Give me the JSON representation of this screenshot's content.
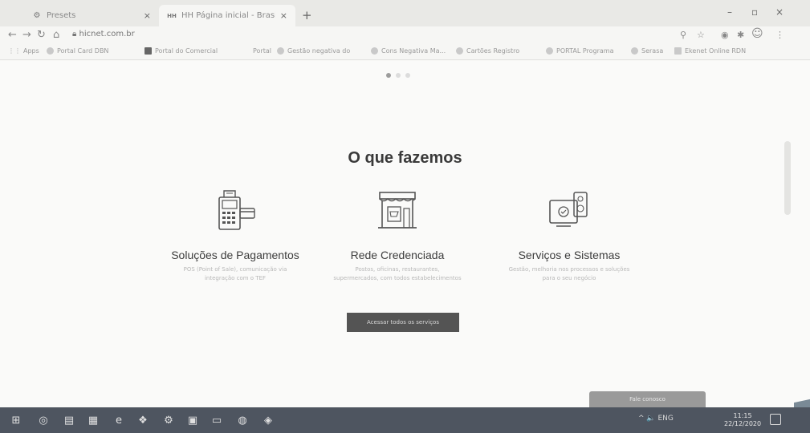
{
  "browser": {
    "tabs": [
      {
        "icon": "gear-icon",
        "label": "Presets"
      },
      {
        "icon": "hh-icon",
        "label": "HH Página inicial - Brasil"
      }
    ],
    "close_glyph": "×",
    "new_tab_glyph": "+",
    "address": "hicnet.com.br",
    "bookmarks": [
      {
        "label": "Apps"
      },
      {
        "label": "Portal Card DBN"
      },
      {
        "label": "Portal do Comercial"
      },
      {
        "label": "Portal"
      },
      {
        "label": "Gestão negativa do"
      },
      {
        "label": "Cons Negativa Ma..."
      },
      {
        "label": "Cartões Registro"
      },
      {
        "label": "PORTAL Programa"
      },
      {
        "label": "Serasa"
      },
      {
        "label": "Ekenet Online RDN"
      }
    ]
  },
  "page": {
    "section_title": "O que fazemos",
    "carousel": {
      "count": 3,
      "active": 0
    },
    "services": [
      {
        "icon": "payment-terminal-icon",
        "title": "Soluções de Pagamentos",
        "description": "POS (Point of Sale), comunicação via integração com o TEF"
      },
      {
        "icon": "storefront-icon",
        "title": "Rede Credenciada",
        "description": "Postos, oficinas, restaurantes, supermercados, com todos estabelecimentos"
      },
      {
        "icon": "systems-screen-icon",
        "title": "Serviços e Sistemas",
        "description": "Gestão, melhoria nos processos e soluções para o seu negócio"
      }
    ],
    "cta_label": "Acessar todos os serviços",
    "chat_label": "Fale conosco"
  },
  "taskbar": {
    "tray": "^ 🔈 ENG",
    "time": "11:15",
    "date": "22/12/2020"
  },
  "colors": {
    "page_bg": "#fafaf9",
    "cta_bg": "#545454",
    "taskbar_bg": "#4e5560"
  }
}
